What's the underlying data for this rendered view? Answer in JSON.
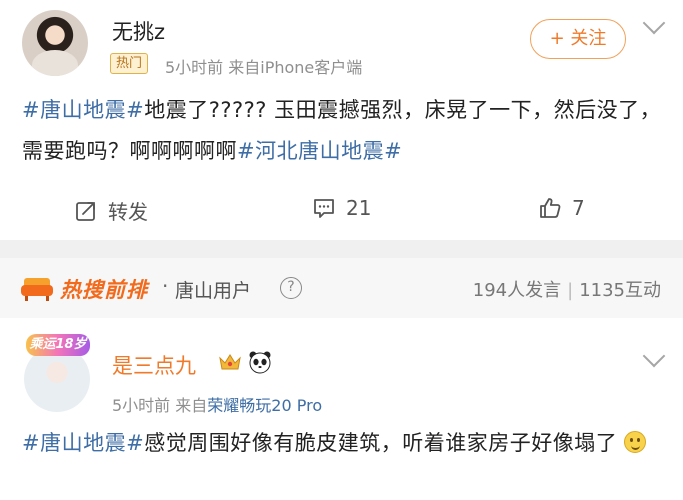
{
  "post1": {
    "username": "无挑z",
    "badge": "热门",
    "meta": "5小时前  来自iPhone客户端",
    "follow_label": "+ 关注",
    "text_tag1": "#唐山地震#",
    "text_body": "地震了?????  玉田震撼强烈，床晃了一下，然后没了，需要跑吗？啊啊啊啊啊",
    "text_tag2": "#河北唐山地震#",
    "repost_label": "转发",
    "comment_count": "21",
    "like_count": "7"
  },
  "hot": {
    "title": "热搜前排",
    "dot": "·",
    "subtitle": "唐山用户",
    "help_glyph": "?",
    "speakers": "194人发言",
    "interactions": "1135互动"
  },
  "post2": {
    "frame_label": "乘运18岁",
    "username": "是三点九",
    "meta_time": "5小时前  来自",
    "meta_source": "荣耀畅玩20 Pro",
    "text_tag": "#唐山地震#",
    "text_body": "感觉周围好像有脆皮建筑，听着谁家房子好像塌了"
  },
  "colors": {
    "accent_orange": "#f07a2a",
    "link_blue": "#3e6ea5",
    "meta_gray": "#8f8f8f"
  }
}
